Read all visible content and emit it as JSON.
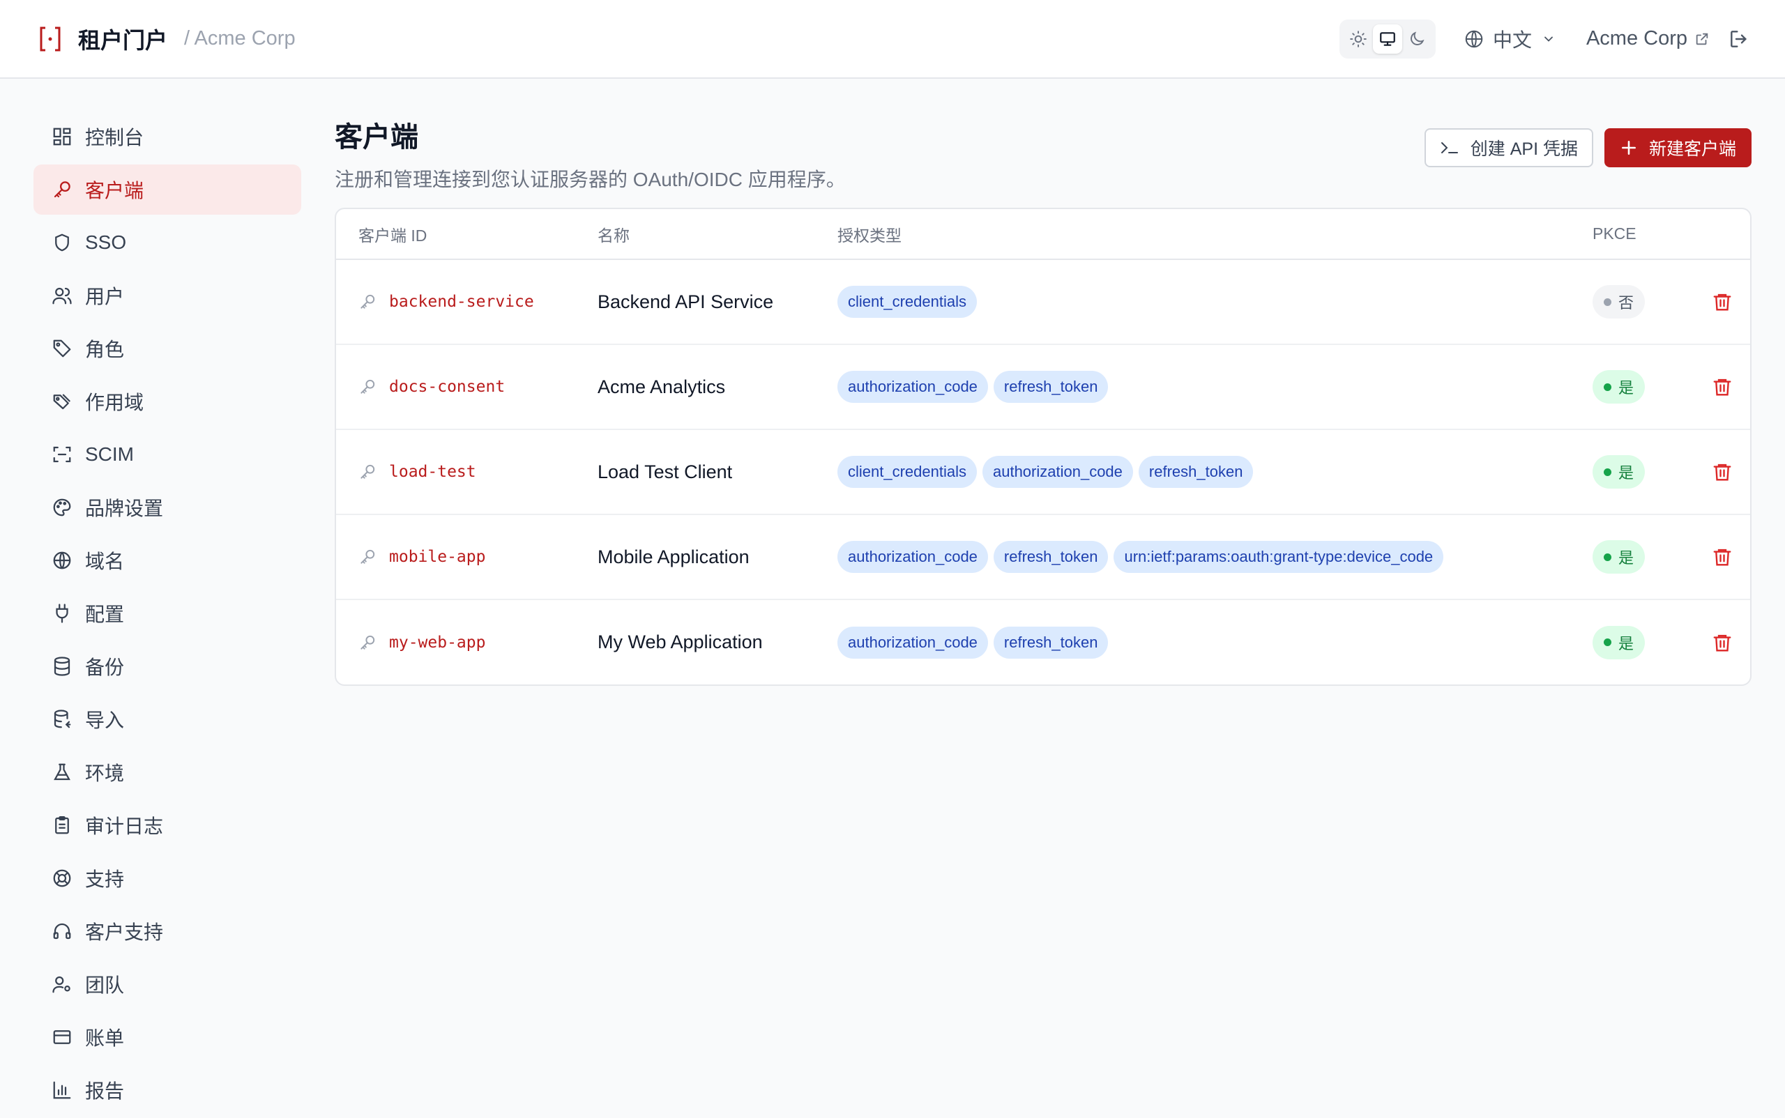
{
  "header": {
    "app_title": "租户门户",
    "tenant_breadcrumb": "/ Acme Corp",
    "language": "中文",
    "tenant_name": "Acme Corp"
  },
  "sidebar": {
    "items": [
      {
        "label": "控制台",
        "icon": "dashboard-icon"
      },
      {
        "label": "客户端",
        "icon": "key-icon",
        "active": true
      },
      {
        "label": "SSO",
        "icon": "shield-icon"
      },
      {
        "label": "用户",
        "icon": "users-icon"
      },
      {
        "label": "角色",
        "icon": "tag-icon"
      },
      {
        "label": "作用域",
        "icon": "tags-icon"
      },
      {
        "label": "SCIM",
        "icon": "scan-icon"
      },
      {
        "label": "品牌设置",
        "icon": "palette-icon"
      },
      {
        "label": "域名",
        "icon": "globe-icon"
      },
      {
        "label": "配置",
        "icon": "plug-icon"
      },
      {
        "label": "备份",
        "icon": "database-icon"
      },
      {
        "label": "导入",
        "icon": "database-import-icon"
      },
      {
        "label": "环境",
        "icon": "flask-icon"
      },
      {
        "label": "审计日志",
        "icon": "clipboard-icon"
      },
      {
        "label": "支持",
        "icon": "lifebuoy-icon"
      },
      {
        "label": "客户支持",
        "icon": "headset-icon"
      },
      {
        "label": "团队",
        "icon": "user-cog-icon"
      },
      {
        "label": "账单",
        "icon": "credit-card-icon"
      },
      {
        "label": "报告",
        "icon": "bar-chart-icon"
      }
    ]
  },
  "page": {
    "title": "客户端",
    "description": "注册和管理连接到您认证服务器的 OAuth/OIDC 应用程序。",
    "create_api_credentials": "创建 API 凭据",
    "new_client": "新建客户端"
  },
  "table": {
    "headers": {
      "client_id": "客户端 ID",
      "name": "名称",
      "grant_types": "授权类型",
      "pkce": "PKCE"
    },
    "rows": [
      {
        "client_id": "backend-service",
        "name": "Backend API Service",
        "grants": [
          "client_credentials"
        ],
        "pkce": "否",
        "pkce_enabled": false
      },
      {
        "client_id": "docs-consent",
        "name": "Acme Analytics",
        "grants": [
          "authorization_code",
          "refresh_token"
        ],
        "pkce": "是",
        "pkce_enabled": true
      },
      {
        "client_id": "load-test",
        "name": "Load Test Client",
        "grants": [
          "client_credentials",
          "authorization_code",
          "refresh_token"
        ],
        "pkce": "是",
        "pkce_enabled": true
      },
      {
        "client_id": "mobile-app",
        "name": "Mobile Application",
        "grants": [
          "authorization_code",
          "refresh_token",
          "urn:ietf:params:oauth:grant-type:device_code"
        ],
        "pkce": "是",
        "pkce_enabled": true
      },
      {
        "client_id": "my-web-app",
        "name": "My Web Application",
        "grants": [
          "authorization_code",
          "refresh_token"
        ],
        "pkce": "是",
        "pkce_enabled": true
      }
    ]
  },
  "colors": {
    "accent": "#b91c1c",
    "chip_bg": "#dbeafe",
    "chip_text": "#1e40af"
  }
}
